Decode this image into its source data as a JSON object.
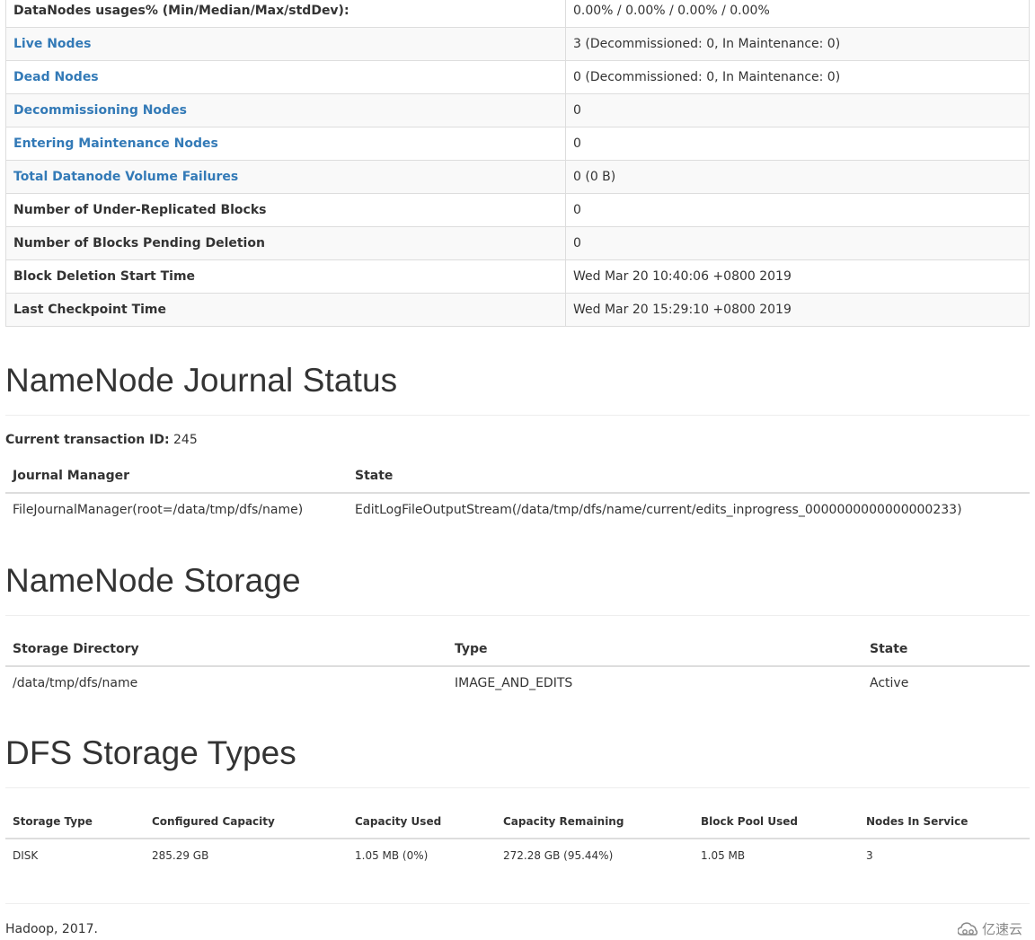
{
  "overview": {
    "rows": [
      {
        "label": "DataNodes usages% (Min/Median/Max/stdDev):",
        "value": "0.00% / 0.00% / 0.00% / 0.00%",
        "link": false
      },
      {
        "label": "Live Nodes",
        "value": "3 (Decommissioned: 0, In Maintenance: 0)",
        "link": true
      },
      {
        "label": "Dead Nodes",
        "value": "0 (Decommissioned: 0, In Maintenance: 0)",
        "link": true
      },
      {
        "label": "Decommissioning Nodes",
        "value": "0",
        "link": true
      },
      {
        "label": "Entering Maintenance Nodes",
        "value": "0",
        "link": true
      },
      {
        "label": "Total Datanode Volume Failures",
        "value": "0 (0 B)",
        "link": true
      },
      {
        "label": "Number of Under-Replicated Blocks",
        "value": "0",
        "link": false
      },
      {
        "label": "Number of Blocks Pending Deletion",
        "value": "0",
        "link": false
      },
      {
        "label": "Block Deletion Start Time",
        "value": "Wed Mar 20 10:40:06 +0800 2019",
        "link": false
      },
      {
        "label": "Last Checkpoint Time",
        "value": "Wed Mar 20 15:29:10 +0800 2019",
        "link": false
      }
    ]
  },
  "journal": {
    "title": "NameNode Journal Status",
    "txid_label": "Current transaction ID:",
    "txid_value": "245",
    "headers": [
      "Journal Manager",
      "State"
    ],
    "rows": [
      [
        "FileJournalManager(root=/data/tmp/dfs/name)",
        "EditLogFileOutputStream(/data/tmp/dfs/name/current/edits_inprogress_0000000000000000233)"
      ]
    ]
  },
  "storage": {
    "title": "NameNode Storage",
    "headers": [
      "Storage Directory",
      "Type",
      "State"
    ],
    "rows": [
      [
        "/data/tmp/dfs/name",
        "IMAGE_AND_EDITS",
        "Active"
      ]
    ]
  },
  "dfs_types": {
    "title": "DFS Storage Types",
    "headers": [
      "Storage Type",
      "Configured Capacity",
      "Capacity Used",
      "Capacity Remaining",
      "Block Pool Used",
      "Nodes In Service"
    ],
    "rows": [
      [
        "DISK",
        "285.29 GB",
        "1.05 MB (0%)",
        "272.28 GB (95.44%)",
        "1.05 MB",
        "3"
      ]
    ]
  },
  "footer": {
    "text": "Hadoop, 2017.",
    "watermark": "亿速云",
    "watermark_icon": "cloud-logo-icon"
  },
  "colors": {
    "link": "#337ab7",
    "text": "#333333",
    "stripe": "#f9f9f9",
    "border": "#dddddd"
  }
}
